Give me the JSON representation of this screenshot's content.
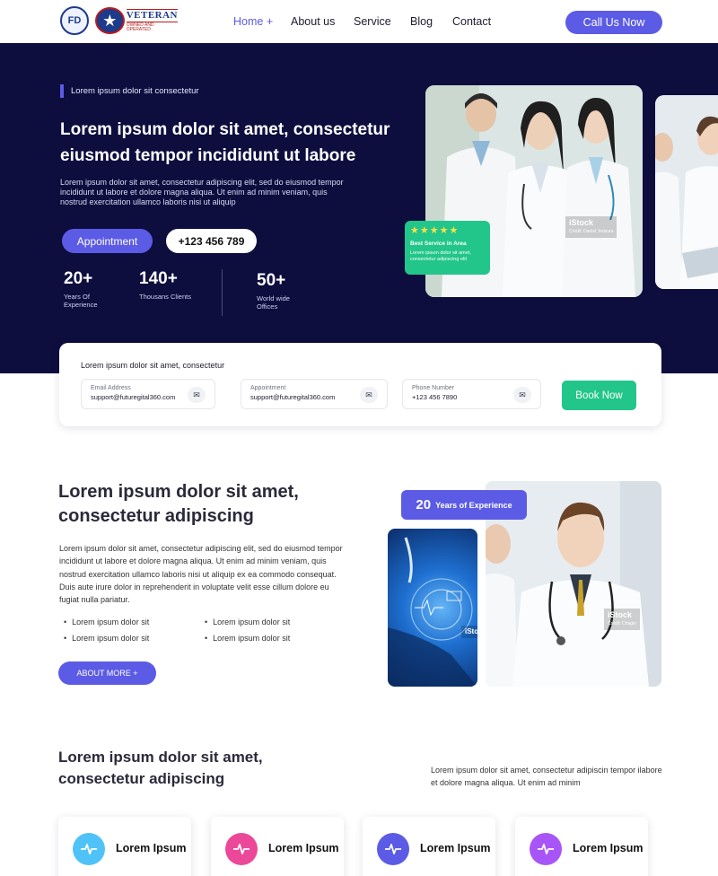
{
  "nav": {
    "logo_fd": "FD",
    "logo_veteran": "VETERAN",
    "logo_veteran_sub": "OWNED AND OPERATED",
    "links": [
      {
        "label": "Home +",
        "active": true
      },
      {
        "label": "About us",
        "active": false
      },
      {
        "label": "Service",
        "active": false
      },
      {
        "label": "Blog",
        "active": false
      },
      {
        "label": "Contact",
        "active": false
      }
    ],
    "cta": "Call Us Now"
  },
  "hero": {
    "tag": "Lorem ipsum dolor sit  consectetur",
    "title": "Lorem ipsum dolor sit amet, consectetur eiusmod tempor incididunt ut labore",
    "description": "Lorem ipsum dolor sit amet, consectetur adipiscing elit, sed do eiusmod tempor incididunt ut labore et dolore magna aliqua. Ut enim ad minim veniam, quis nostrud exercitation ullamco laboris nisi ut aliquip",
    "appointment_label": "Appointment",
    "phone_label": "+123 456 789",
    "stats": [
      {
        "num": "20+",
        "label": "Years Of Experience"
      },
      {
        "num": "140+",
        "label": "Thousans Clients"
      },
      {
        "num": "50+",
        "label": "World wide Offices"
      }
    ],
    "photo_credit": "iStock",
    "photo_credit_sub": "Credit: Daniel Jedzura",
    "badge": {
      "stars": "★★★★★",
      "title": "Best Service in Area",
      "text": "Lorem ipsum dolor sit amet, consectetur adipiscing elit"
    }
  },
  "booking": {
    "title": "Lorem ipsum dolor sit amet, consectetur",
    "fields": [
      {
        "label": "Email Address",
        "value": "support@futuregital360.com"
      },
      {
        "label": "Appointment",
        "value": "support@futuregital360.com"
      },
      {
        "label": "Phone Number",
        "value": "+123 456 7890"
      }
    ],
    "button": "Book Now"
  },
  "about": {
    "title": "Lorem ipsum dolor sit amet, consectetur adipiscing",
    "description": "Lorem ipsum dolor sit amet, consectetur adipiscing elit, sed do eiusmod tempor incididunt ut labore et dolore magna aliqua. Ut enim ad minim veniam, quis nostrud exercitation ullamco laboris nisi ut aliquip ex ea commodo consequat. Duis aute irure dolor in reprehenderit in voluptate velit esse cillum dolore eu fugiat nulla pariatur.",
    "bullets": [
      "Lorem ipsum dolor sit",
      "Lorem ipsum dolor sit",
      "Lorem ipsum dolor sit",
      "Lorem ipsum dolor sit"
    ],
    "button": "ABOUT MORE +",
    "experience_num": "20",
    "experience_text": "Years of Experience",
    "photo_credit": "iStock",
    "photo_credit_sub": "Credit: Chagin",
    "photo_credit_small": "iSto"
  },
  "services": {
    "title": "Lorem ipsum dolor sit amet, consectetur adipiscing",
    "description": "Lorem ipsum dolor sit amet, consectetur adipiscin tempor ilabore et dolore magna aliqua. Ut enim ad minim",
    "cards": [
      {
        "label": "Lorem Ipsum",
        "icon": "pulse-icon",
        "color": "#4fc3f7"
      },
      {
        "label": "Lorem Ipsum",
        "icon": "pulse-icon",
        "color": "#ec4899"
      },
      {
        "label": "Lorem Ipsum",
        "icon": "pulse-icon",
        "color": "#5b5be6"
      },
      {
        "label": "Lorem Ipsum",
        "icon": "pulse-icon",
        "color": "#a855f7"
      }
    ]
  },
  "colors": {
    "primary": "#5b5be6",
    "hero_bg": "#0d0d3e",
    "accent_green": "#22c58a"
  }
}
